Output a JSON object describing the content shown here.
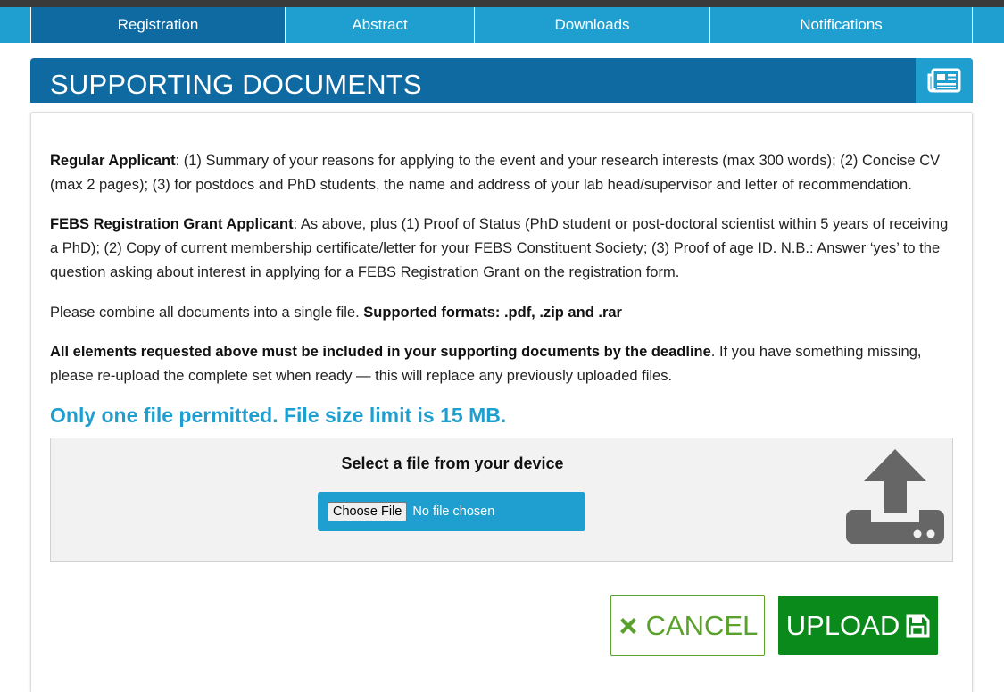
{
  "nav": {
    "tabs": [
      {
        "label": "Registration",
        "active": true
      },
      {
        "label": "Abstract"
      },
      {
        "label": "Downloads"
      },
      {
        "label": "Notifications"
      }
    ]
  },
  "header": {
    "title": "SUPPORTING DOCUMENTS",
    "icon": "newspaper-icon"
  },
  "content": {
    "regular": {
      "heading": "Regular Applicant",
      "text": ": (1) Summary of your reasons for applying to the event and your research interests (max 300 words); (2) Concise CV (max 2 pages); (3) for postdocs and PhD students, the name and address of your lab head/supervisor and letter of recommendation."
    },
    "grant": {
      "heading": "FEBS Registration Grant Applicant",
      "text": ": As above, plus (1) Proof of Status (PhD student or post-doctoral scientist within 5 years of receiving a PhD); (2) Copy of current membership certificate/letter for your FEBS Constituent Society; (3) Proof of age ID. N.B.: Answer ‘yes’ to the question asking about interest in applying for a FEBS Registration Grant on the registration form."
    },
    "combine": {
      "text": "Please combine all documents into a single file. ",
      "formats": "Supported formats: .pdf, .zip and .rar"
    },
    "deadline": {
      "heading": "All elements requested above must be included in your supporting documents by the deadline",
      "text": ". If you have something missing, please re-upload the complete set when ready — this will replace any previously uploaded files."
    },
    "limit": "Only one file permitted. File size limit is 15 MB."
  },
  "dropzone": {
    "label": "Select a file from your device",
    "choose_button": "Choose File",
    "status": "No file chosen",
    "icon": "upload-icon"
  },
  "actions": {
    "cancel": "CANCEL",
    "upload": "UPLOAD"
  },
  "colors": {
    "nav": "#1e9fd0",
    "nav_active": "#0f6aa2",
    "header": "#0f6aa2",
    "accent": "#1e9fd0",
    "cancel": "#5aa02c",
    "upload": "#0a8a1a"
  }
}
